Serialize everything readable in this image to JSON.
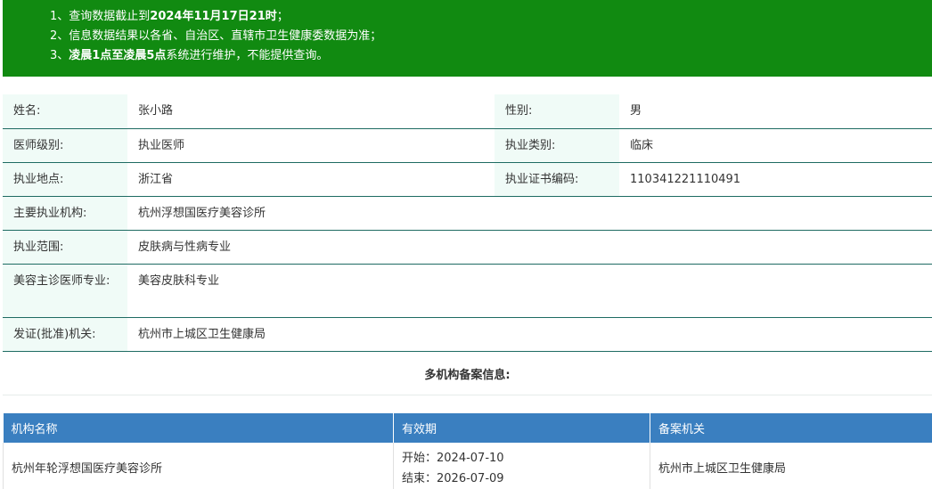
{
  "notice": {
    "line1_prefix": "1、查询数据截止到",
    "line1_bold": "2024年11月17日21时",
    "line1_suffix": "；",
    "line2": "2、信息数据结果以各省、自治区、直辖市卫生健康委数据为准；",
    "line3_prefix": "3、",
    "line3_bold": "凌晨1点至凌晨5点",
    "line3_suffix": "系统进行维护，不能提供查询。"
  },
  "info": {
    "name_label": "姓名:",
    "name_value": "张小路",
    "gender_label": "性别:",
    "gender_value": "男",
    "level_label": "医师级别:",
    "level_value": "执业医师",
    "category_label": "执业类别:",
    "category_value": "临床",
    "place_label": "执业地点:",
    "place_value": "浙江省",
    "cert_label": "执业证书编码:",
    "cert_value": "110341221110491",
    "org_label": "主要执业机构:",
    "org_value": "杭州浮想国医疗美容诊所",
    "scope_label": "执业范围:",
    "scope_value": "皮肤病与性病专业",
    "beauty_label": "美容主诊医师专业:",
    "beauty_value": "美容皮肤科专业",
    "issuer_label": "发证(批准)机关:",
    "issuer_value": "杭州市上城区卫生健康局"
  },
  "multi": {
    "title": "多机构备案信息:",
    "headers": [
      "机构名称",
      "有效期",
      "备案机关"
    ],
    "rows": [
      {
        "org": "杭州年轮浮想国医疗美容诊所",
        "start": "开始：2024-07-10",
        "end": "结束：2026-07-09",
        "authority": "杭州市上城区卫生健康局"
      }
    ]
  }
}
